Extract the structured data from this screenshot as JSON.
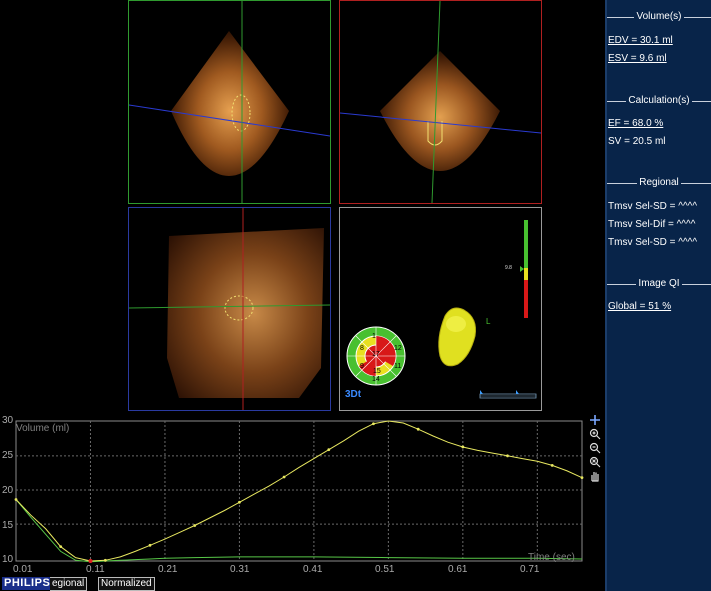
{
  "sidebar": {
    "volumes": {
      "title": "Volume(s)",
      "edv": "EDV = 30.1 ml",
      "esv": "ESV = 9.6 ml"
    },
    "calculations": {
      "title": "Calculation(s)",
      "ef": "EF = 68.0 %",
      "sv": "SV = 20.5 ml"
    },
    "regional": {
      "title": "Regional",
      "items": [
        "Tmsv Sel-SD = ^^^^",
        "Tmsv Sel-Dif = ^^^^",
        "Tmsv Sel-SD = ^^^^"
      ]
    },
    "image_qi": {
      "title": "Image QI",
      "global": "Global = 51 %"
    }
  },
  "views": {
    "bullseye_label": "3Dt",
    "bullseye_segments": [
      "1",
      "8",
      "12",
      "9",
      "11",
      "15",
      "17",
      "14"
    ],
    "model_label": "L",
    "scale_marker": "9.8"
  },
  "graph": {
    "ylabel": "Volume (ml)",
    "xlabel": "Time (sec)",
    "y_ticks": [
      "30",
      "25",
      "20",
      "15",
      "10"
    ],
    "x_ticks": [
      "0.01",
      "0.11",
      "0.21",
      "0.31",
      "0.41",
      "0.51",
      "0.61",
      "0.71"
    ]
  },
  "chart_data": {
    "type": "line",
    "title": "",
    "xlabel": "Time (sec)",
    "ylabel": "Volume (ml)",
    "xlim": [
      0.01,
      0.77
    ],
    "ylim": [
      9.6,
      30.1
    ],
    "grid": true,
    "series": [
      {
        "name": "",
        "color": "#e8e860",
        "x": [
          0.01,
          0.03,
          0.05,
          0.07,
          0.09,
          0.11,
          0.13,
          0.15,
          0.17,
          0.19,
          0.21,
          0.23,
          0.25,
          0.27,
          0.29,
          0.31,
          0.33,
          0.35,
          0.37,
          0.39,
          0.41,
          0.43,
          0.45,
          0.47,
          0.49,
          0.51,
          0.53,
          0.55,
          0.57,
          0.59,
          0.61,
          0.63,
          0.65,
          0.67,
          0.69,
          0.71,
          0.73,
          0.75,
          0.77
        ],
        "values": [
          18.6,
          16.3,
          14.3,
          11.7,
          10.1,
          9.6,
          9.7,
          10.2,
          11.0,
          11.9,
          12.8,
          13.8,
          14.8,
          15.9,
          17.0,
          18.2,
          19.4,
          20.6,
          21.9,
          23.3,
          24.6,
          25.9,
          27.2,
          28.6,
          29.7,
          30.1,
          29.8,
          28.9,
          27.9,
          27.0,
          26.3,
          25.8,
          25.4,
          25.0,
          24.6,
          24.2,
          23.6,
          22.8,
          21.8
        ]
      },
      {
        "name": "",
        "color": "#58c848",
        "x": [
          0.01,
          0.03,
          0.05,
          0.07,
          0.09,
          0.11,
          0.13,
          0.15,
          0.17,
          0.19,
          0.21,
          0.25,
          0.31,
          0.41,
          0.51,
          0.61,
          0.71,
          0.77
        ],
        "values": [
          18.6,
          16.0,
          13.5,
          11.0,
          9.7,
          9.5,
          9.6,
          9.7,
          9.8,
          9.9,
          10.0,
          10.1,
          10.2,
          10.2,
          10.1,
          10.0,
          10.0,
          9.9
        ]
      }
    ]
  },
  "bottom": {
    "brand": "PHILIPS",
    "tab_regional": "egional",
    "tab_normalized": "Normalized"
  },
  "colors": {
    "sidebar_bg": "#082449",
    "view_green": "#2f9a2f",
    "view_red": "#b02020",
    "view_blue": "#2a3aa0",
    "curve_yellow": "#e8e860",
    "curve_green": "#58c848"
  }
}
